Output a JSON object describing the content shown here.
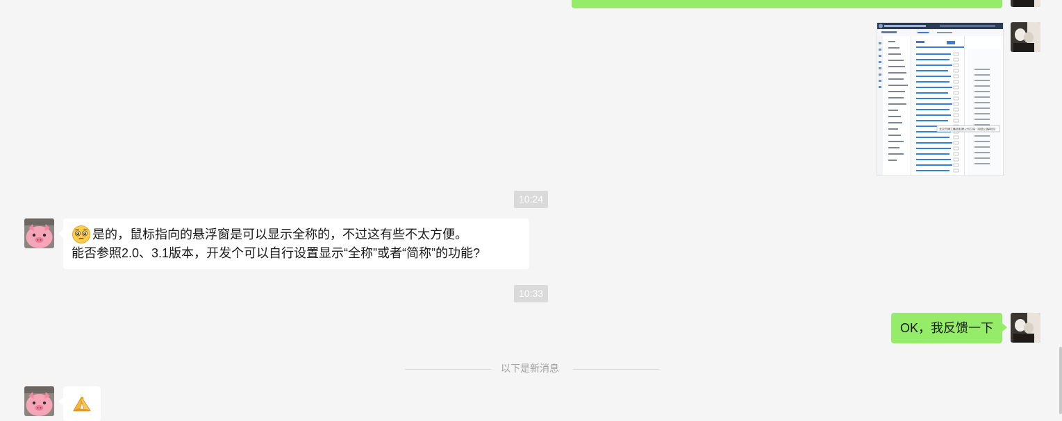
{
  "messages": {
    "timestamp_1": "10:24",
    "incoming_1": {
      "line_1": "是的，鼠标指向的悬浮窗是可以显示全称的，不过这有些不太方便。",
      "line_2": "能否参照2.0、3.1版本，开发个可以自行设置显示“全称”或者“简称”的功能?"
    },
    "timestamp_2": "10:33",
    "outgoing_1": "OK，我反馈一下",
    "divider": "以下是新消息"
  },
  "screenshot_thumbnail": {
    "tooltip": "北京市建工集团有限公司工程（和谐公路项目）"
  },
  "icons": {
    "emoji_1": "pleading-face-icon",
    "emoji_2": "folded-hands-icon",
    "contact_avatar": "pig-avatar-icon",
    "self_avatar": "photo-avatar-icon"
  },
  "colors": {
    "background": "#f5f5f5",
    "outgoing_bubble": "#95ec69",
    "incoming_bubble": "#ffffff",
    "timestamp_bg": "#dadada"
  }
}
